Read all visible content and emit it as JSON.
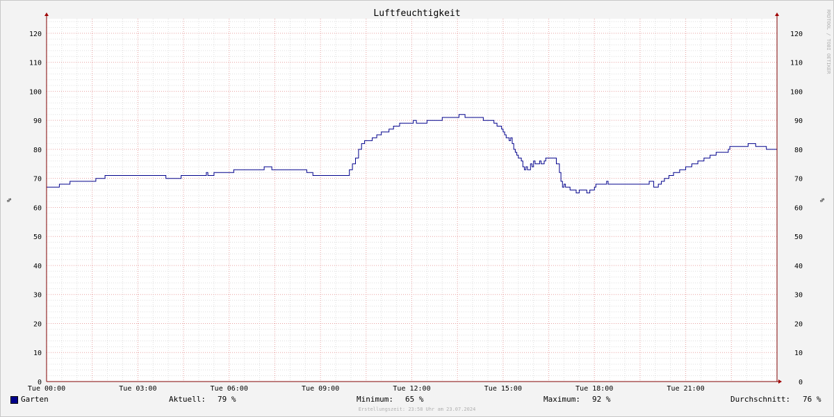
{
  "chart_data": {
    "type": "line",
    "title": "Luftfeuchtigkeit",
    "ylabel": "%",
    "ylim": [
      0,
      125
    ],
    "yticks": [
      0,
      10,
      20,
      30,
      40,
      50,
      60,
      70,
      80,
      90,
      100,
      110,
      120
    ],
    "xlim_hours": [
      0,
      24
    ],
    "xticks": [
      "Tue 00:00",
      "Tue 03:00",
      "Tue 06:00",
      "Tue 09:00",
      "Tue 12:00",
      "Tue 15:00",
      "Tue 18:00",
      "Tue 21:00"
    ],
    "grid": true,
    "legend_position": "bottom",
    "watermark": "RRDTOOL / TOBI OETIKER",
    "colors": {
      "line": "#00008b",
      "major_grid": "#e8a0a0",
      "minor_grid": "#dddddd",
      "axis": "#800000",
      "arrow": "#a00000"
    },
    "series": [
      {
        "name": "Garten",
        "x_hours": [
          0,
          0.4,
          0.42,
          0.75,
          0.77,
          1.6,
          1.62,
          1.9,
          1.92,
          3.9,
          3.92,
          4.4,
          4.42,
          5.2,
          5.25,
          5.3,
          5.35,
          5.5,
          5.55,
          6.1,
          6.15,
          7.1,
          7.15,
          7.35,
          7.4,
          8.5,
          8.55,
          8.7,
          8.75,
          9.9,
          9.95,
          10.05,
          10.15,
          10.25,
          10.35,
          10.45,
          10.55,
          10.7,
          10.85,
          11.0,
          11.1,
          11.25,
          11.4,
          11.6,
          11.8,
          12.0,
          12.05,
          12.15,
          12.45,
          12.5,
          12.95,
          13.0,
          13.5,
          13.55,
          13.7,
          13.75,
          14.3,
          14.35,
          14.6,
          14.7,
          14.8,
          14.9,
          14.95,
          15.0,
          15.05,
          15.1,
          15.15,
          15.2,
          15.25,
          15.3,
          15.35,
          15.4,
          15.45,
          15.5,
          15.55,
          15.6,
          15.65,
          15.7,
          15.75,
          15.8,
          15.85,
          15.9,
          15.95,
          16.0,
          16.05,
          16.1,
          16.15,
          16.2,
          16.25,
          16.3,
          16.35,
          16.4,
          16.5,
          16.55,
          16.7,
          16.75,
          16.85,
          16.9,
          16.95,
          17.0,
          17.05,
          17.1,
          17.15,
          17.2,
          17.25,
          17.3,
          17.4,
          17.5,
          17.6,
          17.7,
          17.75,
          17.8,
          17.85,
          17.95,
          18.0,
          18.05,
          18.1,
          18.3,
          18.35,
          18.4,
          18.45,
          19.5,
          19.55,
          19.8,
          19.85,
          19.9,
          19.95,
          20.05,
          20.1,
          20.2,
          20.3,
          20.45,
          20.6,
          20.8,
          21.0,
          21.2,
          21.4,
          21.6,
          21.8,
          22.0,
          22.4,
          22.45,
          23.0,
          23.05,
          23.25,
          23.3,
          23.6,
          23.65,
          24.0
        ],
        "values": [
          67,
          67,
          68,
          68,
          69,
          69,
          70,
          70,
          71,
          71,
          70,
          70,
          71,
          71,
          72,
          71,
          71,
          72,
          72,
          72,
          73,
          73,
          74,
          74,
          73,
          73,
          72,
          72,
          71,
          71,
          73,
          75,
          77,
          80,
          82,
          83,
          83,
          84,
          85,
          86,
          86,
          87,
          88,
          89,
          89,
          89,
          90,
          89,
          89,
          90,
          90,
          91,
          91,
          92,
          92,
          91,
          91,
          90,
          90,
          89,
          88,
          88,
          87,
          86,
          85,
          84,
          84,
          83,
          84,
          82,
          80,
          79,
          78,
          77,
          77,
          76,
          74,
          73,
          74,
          73,
          73,
          75,
          74,
          76,
          75,
          75,
          75,
          76,
          75,
          75,
          76,
          77,
          77,
          77,
          77,
          75,
          72,
          69,
          67,
          68,
          67,
          67,
          67,
          66,
          66,
          66,
          65,
          66,
          66,
          66,
          65,
          65,
          66,
          66,
          67,
          68,
          68,
          68,
          68,
          69,
          68,
          68,
          68,
          69,
          69,
          69,
          67,
          67,
          68,
          69,
          70,
          71,
          72,
          73,
          74,
          75,
          76,
          77,
          78,
          79,
          80,
          81,
          81,
          82,
          82,
          81,
          81,
          80,
          80,
          79,
          79
        ]
      }
    ]
  },
  "legend": {
    "name": "Garten",
    "current_label": "Aktuell:",
    "current_value": "79 %",
    "min_label": "Minimum:",
    "min_value": "65 %",
    "max_label": "Maximum:",
    "max_value": "92 %",
    "avg_label": "Durchschnitt:",
    "avg_value": "76 %"
  },
  "footer": "Erstellungszeit: 23:58 Uhr am 23.07.2024"
}
